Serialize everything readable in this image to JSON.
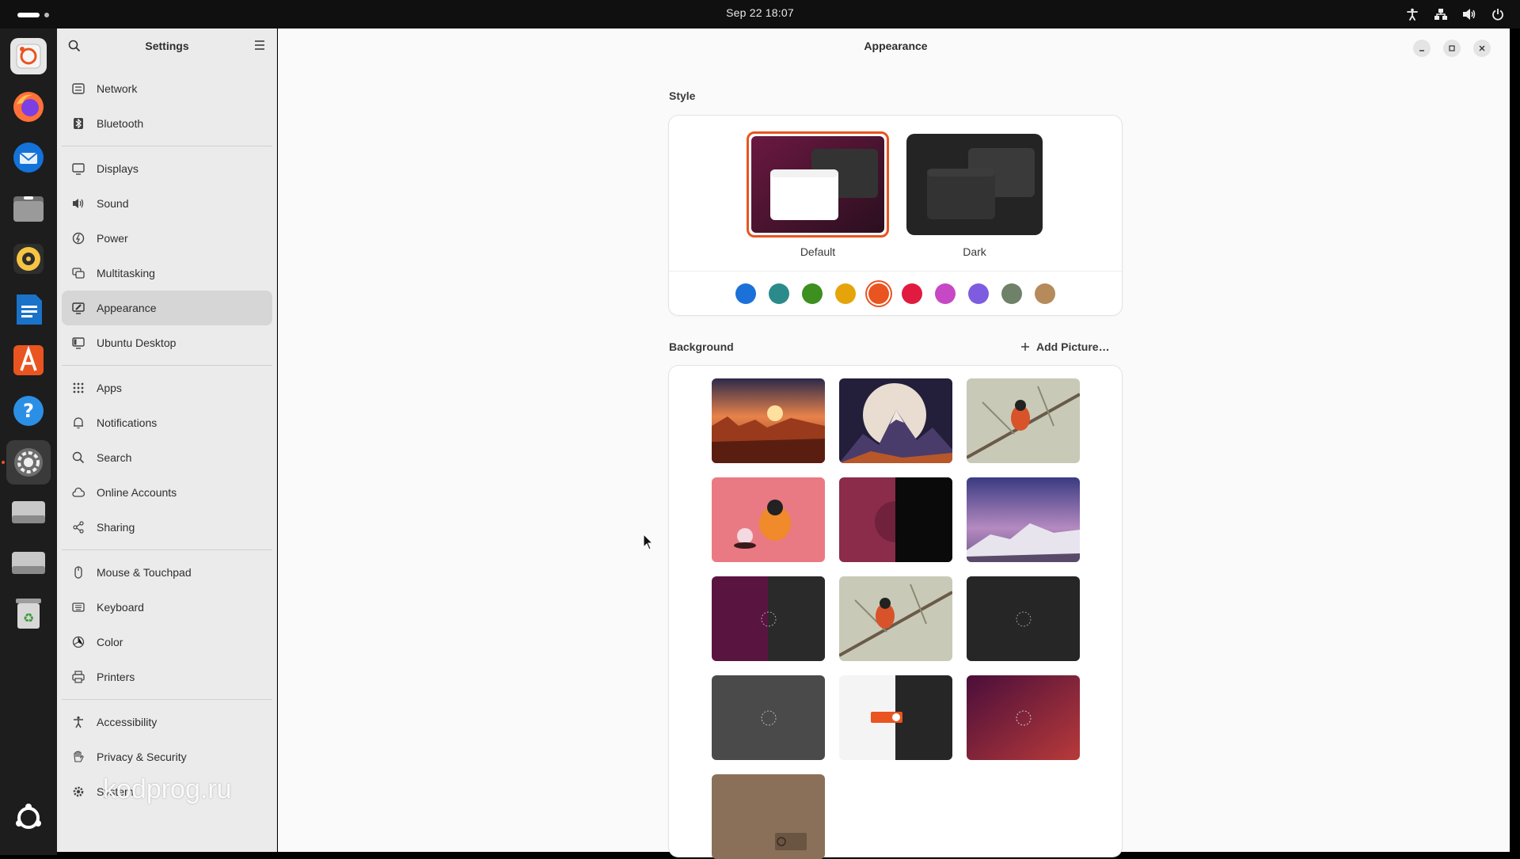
{
  "topbar": {
    "clock": "Sep 22  18:07",
    "tray_icons": [
      "accessibility-icon",
      "network-icon",
      "volume-icon",
      "power-icon"
    ]
  },
  "dock": {
    "apps": [
      "app-center-icon",
      "firefox-icon",
      "thunderbird-icon",
      "files-icon",
      "rhythmbox-icon",
      "writer-icon",
      "app-center-store-icon",
      "help-icon",
      "settings-icon",
      "drive-icon",
      "drive-icon",
      "trash-icon"
    ],
    "show_apps": "show-apps-icon"
  },
  "sidebar": {
    "title": "Settings",
    "groups": [
      [
        {
          "label": "Network",
          "icon": "network-icon"
        },
        {
          "label": "Bluetooth",
          "icon": "bluetooth-icon"
        }
      ],
      [
        {
          "label": "Displays",
          "icon": "display-icon"
        },
        {
          "label": "Sound",
          "icon": "sound-icon"
        },
        {
          "label": "Power",
          "icon": "power-icon"
        },
        {
          "label": "Multitasking",
          "icon": "multitasking-icon"
        },
        {
          "label": "Appearance",
          "icon": "appearance-icon",
          "active": true
        },
        {
          "label": "Ubuntu Desktop",
          "icon": "ubuntu-desktop-icon"
        }
      ],
      [
        {
          "label": "Apps",
          "icon": "apps-icon"
        },
        {
          "label": "Notifications",
          "icon": "bell-icon"
        },
        {
          "label": "Search",
          "icon": "search-icon"
        },
        {
          "label": "Online Accounts",
          "icon": "cloud-icon"
        },
        {
          "label": "Sharing",
          "icon": "share-icon"
        }
      ],
      [
        {
          "label": "Mouse & Touchpad",
          "icon": "mouse-icon"
        },
        {
          "label": "Keyboard",
          "icon": "keyboard-icon"
        },
        {
          "label": "Color",
          "icon": "color-icon"
        },
        {
          "label": "Printers",
          "icon": "printer-icon"
        }
      ],
      [
        {
          "label": "Accessibility",
          "icon": "accessibility-icon"
        },
        {
          "label": "Privacy & Security",
          "icon": "hand-icon"
        },
        {
          "label": "System",
          "icon": "gear-icon"
        }
      ]
    ]
  },
  "main": {
    "title": "Appearance",
    "style": {
      "label": "Style",
      "options": [
        {
          "label": "Default",
          "selected": true
        },
        {
          "label": "Dark",
          "selected": false
        }
      ],
      "accents": [
        "#1c71d8",
        "#2b8b8b",
        "#3d8f1f",
        "#e5a50a",
        "#e95420",
        "#e01b3f",
        "#c748c4",
        "#7e5ce0",
        "#6f8168",
        "#b58b5c"
      ],
      "selected_accent": 4
    },
    "background": {
      "label": "Background",
      "add_label": "Add Picture…"
    }
  },
  "watermark": "kodprog.ru"
}
